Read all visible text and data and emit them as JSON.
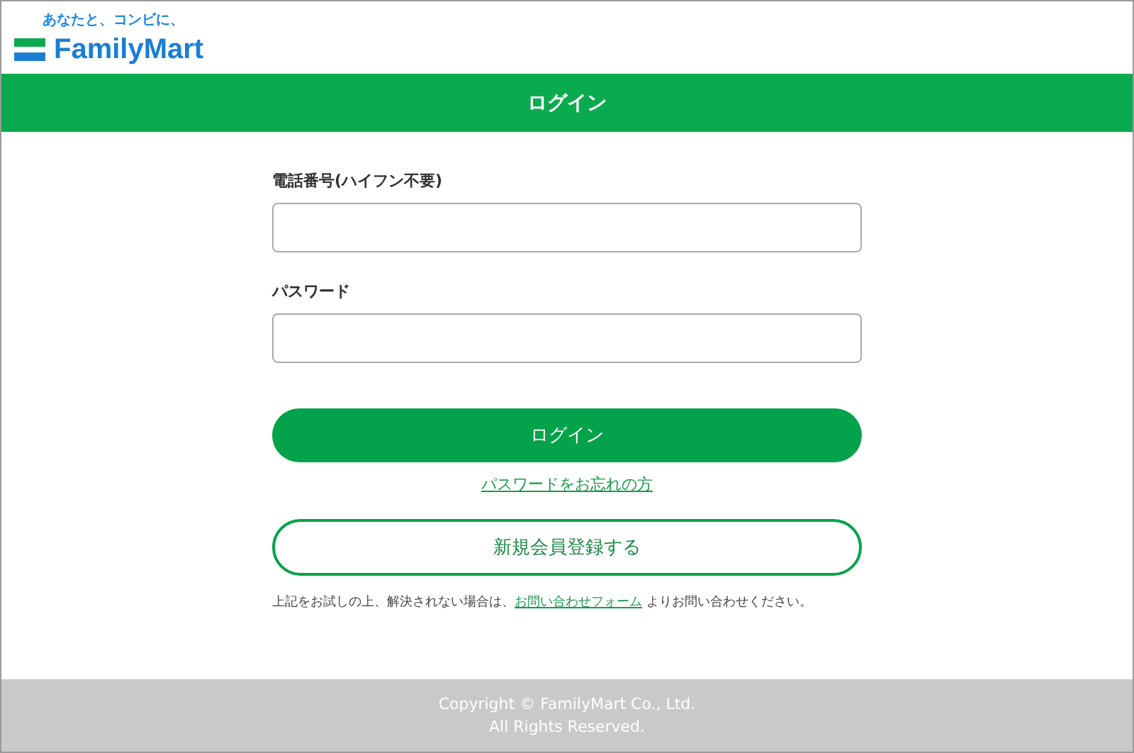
{
  "logo": {
    "tagline": "あなたと、コンビに、",
    "brand": "FamilyMart"
  },
  "title_bar": {
    "title": "ログイン"
  },
  "fields": [
    {
      "label": "電話番号(ハイフン不要)"
    },
    {
      "label": "パスワード"
    }
  ],
  "login_button": "ログイン",
  "forgot_link": "パスワードをお忘れの方",
  "register_button": "新規会員登録する",
  "note": {
    "before": "上記をお試しの上、解決されない場合は、",
    "link": "お問い合わせフォーム",
    "after": " よりお問い合わせください。"
  },
  "footer": [
    "Copyright © FamilyMart Co., Ltd.",
    "All Rights Reserved."
  ]
}
